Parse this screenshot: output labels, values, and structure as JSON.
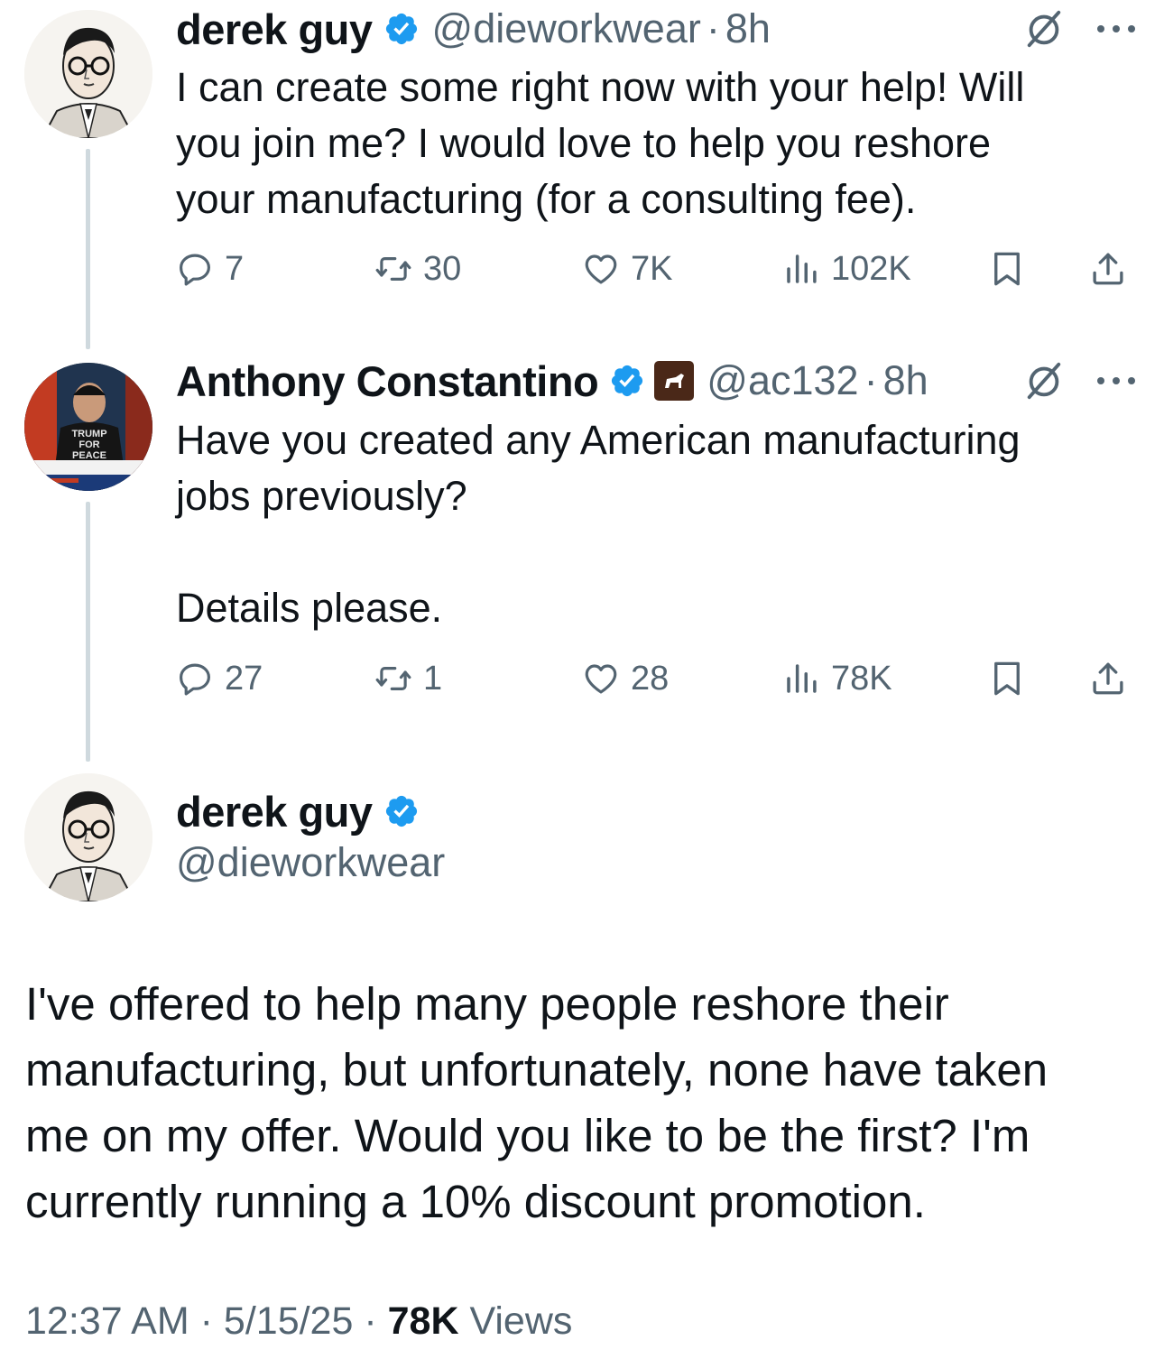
{
  "tweets": [
    {
      "name": "derek guy",
      "handle": "@dieworkwear",
      "time": "8h",
      "text": "I can create some right now with your help! Will\nyou join me? I would love to help you reshore\nyour manufacturing (for a consulting fee).",
      "replies": "7",
      "reposts": "30",
      "likes": "7K",
      "views": "102K"
    },
    {
      "name": "Anthony Constantino",
      "handle": "@ac132",
      "time": "8h",
      "text": "Have you created any American manufacturing\njobs previously?\n\nDetails please.",
      "replies": "27",
      "reposts": "1",
      "likes": "28",
      "views": "78K",
      "avatar_shirt_text": [
        "TRUMP",
        "FOR",
        "PEACE"
      ]
    }
  ],
  "main_tweet": {
    "name": "derek guy",
    "handle": "@dieworkwear",
    "text": "I've offered to help many people reshore their\nmanufacturing, but unfortunately, none have taken\nme on my offer. Would you like to be the first? I'm\ncurrently running a 10% discount promotion.",
    "time": "12:37 AM",
    "date": "5/15/25",
    "views_count": "78K",
    "views_label": "Views",
    "separator": "·"
  },
  "icons": {
    "verified": "verified-badge-icon",
    "reply": "reply-bubble-icon",
    "repost": "repost-arrows-icon",
    "like": "heart-icon",
    "views": "bar-chart-icon",
    "bookmark": "bookmark-icon",
    "share": "share-upload-icon",
    "grok": "grok-slash-circle-icon",
    "more": "more-dots-icon"
  },
  "colors": {
    "text": "#0f1419",
    "secondary": "#536471",
    "verified_blue": "#1d9bf0",
    "thread_line": "#cfd9de",
    "affiliate_badge": "#4a2818"
  }
}
